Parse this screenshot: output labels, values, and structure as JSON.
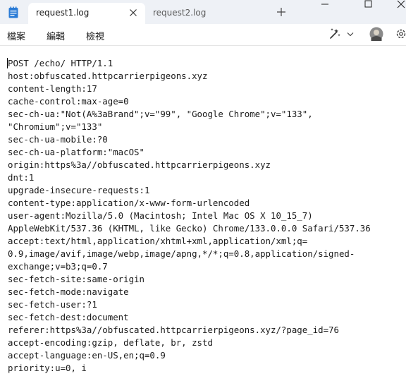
{
  "tabs": [
    {
      "label": "request1.log",
      "active": true
    },
    {
      "label": "request2.log",
      "active": false
    }
  ],
  "menu": [
    "檔案",
    "編輯",
    "檢視"
  ],
  "content_lines": [
    "POST /echo/ HTTP/1.1",
    "host:obfuscated.httpcarrierpigeons.xyz",
    "content-length:17",
    "cache-control:max-age=0",
    "sec-ch-ua:\"Not(A%3aBrand\";v=\"99\", \"Google Chrome\";v=\"133\",",
    "\"Chromium\";v=\"133\"",
    "sec-ch-ua-mobile:?0",
    "sec-ch-ua-platform:\"macOS\"",
    "origin:https%3a//obfuscated.httpcarrierpigeons.xyz",
    "dnt:1",
    "upgrade-insecure-requests:1",
    "content-type:application/x-www-form-urlencoded",
    "user-agent:Mozilla/5.0 (Macintosh; Intel Mac OS X 10_15_7)",
    "AppleWebKit/537.36 (KHTML, like Gecko) Chrome/133.0.0.0 Safari/537.36",
    "accept:text/html,application/xhtml+xml,application/xml;q=",
    "0.9,image/avif,image/webp,image/apng,*/*;q=0.8,application/signed-",
    "exchange;v=b3;q=0.7",
    "sec-fetch-site:same-origin",
    "sec-fetch-mode:navigate",
    "sec-fetch-user:?1",
    "sec-fetch-dest:document",
    "referer:https%3a//obfuscated.httpcarrierpigeons.xyz/?page_id=76",
    "accept-encoding:gzip, deflate, br, zstd",
    "accept-language:en-US,en;q=0.9",
    "priority:u=0, i"
  ]
}
